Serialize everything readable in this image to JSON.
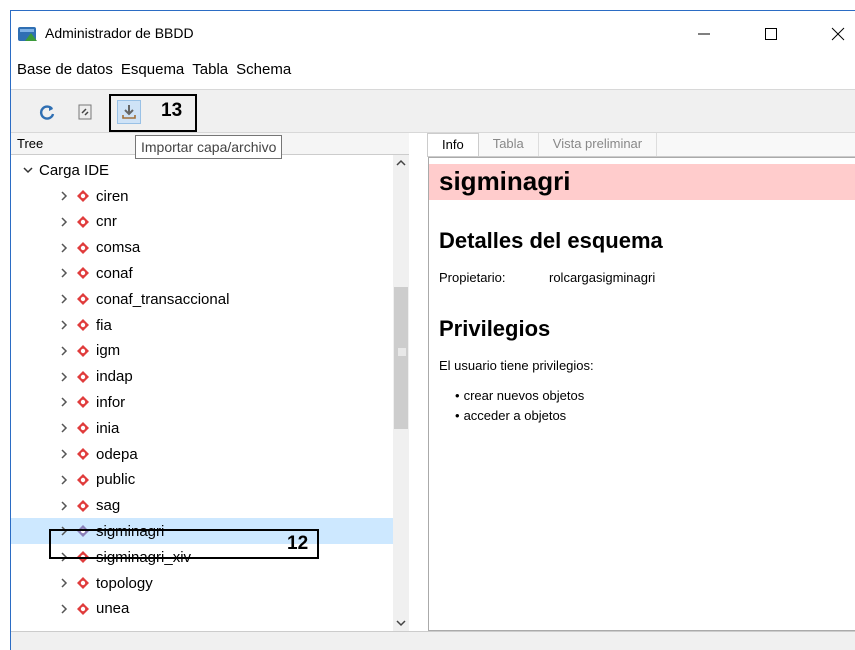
{
  "window": {
    "title": "Administrador de BBDD"
  },
  "menu": {
    "items": [
      "Base de datos",
      "Esquema",
      "Tabla",
      "Schema"
    ]
  },
  "toolbar": {
    "callout_label": "13",
    "tooltip": "Importar capa/archivo"
  },
  "tree": {
    "header": "Tree",
    "root": "Carga IDE",
    "items": [
      "ciren",
      "cnr",
      "comsa",
      "conaf",
      "conaf_transaccional",
      "fia",
      "igm",
      "indap",
      "infor",
      "inia",
      "odepa",
      "public",
      "sag",
      "sigminagri",
      "sigminagri_xiv",
      "topology",
      "unea"
    ],
    "selected": "sigminagri",
    "callout_label": "12"
  },
  "tabs": [
    "Info",
    "Tabla",
    "Vista preliminar"
  ],
  "info": {
    "schema_name": "sigminagri",
    "details_heading": "Detalles del esquema",
    "owner_label": "Propietario:",
    "owner_value": "rolcargasigminagri",
    "privileges_heading": "Privilegios",
    "privileges_text": "El usuario tiene privilegios:",
    "privileges": [
      "crear nuevos objetos",
      "acceder a objetos"
    ]
  },
  "colors": {
    "title_band": "#ffcccc",
    "selection": "#cde8ff",
    "schema_icon": "#e03c3c",
    "selected_icon": "#8a7fb8"
  }
}
